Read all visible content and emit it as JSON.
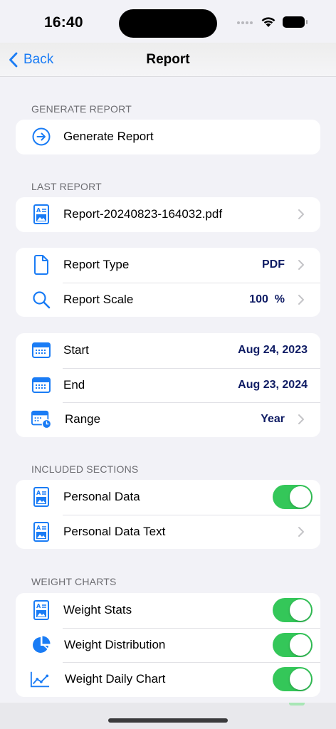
{
  "status_bar": {
    "time": "16:40"
  },
  "nav": {
    "back_label": "Back",
    "title": "Report"
  },
  "sections": {
    "generate": {
      "header": "GENERATE REPORT",
      "rows": [
        {
          "label": "Generate Report",
          "icon": "arrow-circle-icon"
        }
      ]
    },
    "last_report": {
      "header": "LAST REPORT",
      "rows": [
        {
          "label": "Report-20240823-164032.pdf",
          "icon": "document-image-icon"
        }
      ]
    },
    "report_settings": {
      "rows": [
        {
          "label": "Report Type",
          "value": "PDF",
          "icon": "document-icon"
        },
        {
          "label": "Report Scale",
          "value": "100  %",
          "icon": "magnifier-icon"
        }
      ]
    },
    "date_range": {
      "rows": [
        {
          "label": "Start",
          "value": "Aug 24, 2023",
          "icon": "calendar-icon"
        },
        {
          "label": "End",
          "value": "Aug 23, 2024",
          "icon": "calendar-icon"
        },
        {
          "label": "Range",
          "value": "Year",
          "icon": "calendar-clock-icon"
        }
      ]
    },
    "included": {
      "header": "INCLUDED SECTIONS",
      "rows": [
        {
          "label": "Personal Data",
          "toggle": true,
          "icon": "document-image-icon"
        },
        {
          "label": "Personal Data Text",
          "icon": "document-image-icon"
        }
      ]
    },
    "weight_charts": {
      "header": "WEIGHT CHARTS",
      "rows": [
        {
          "label": "Weight Stats",
          "toggle": true,
          "icon": "document-image-icon"
        },
        {
          "label": "Weight Distribution",
          "toggle": true,
          "icon": "pie-chart-icon"
        },
        {
          "label": "Weight Daily Chart",
          "toggle": true,
          "icon": "line-chart-icon"
        }
      ]
    }
  },
  "colors": {
    "accent": "#1a7cf5",
    "value_text": "#0f1c64",
    "toggle_on": "#34c759"
  }
}
